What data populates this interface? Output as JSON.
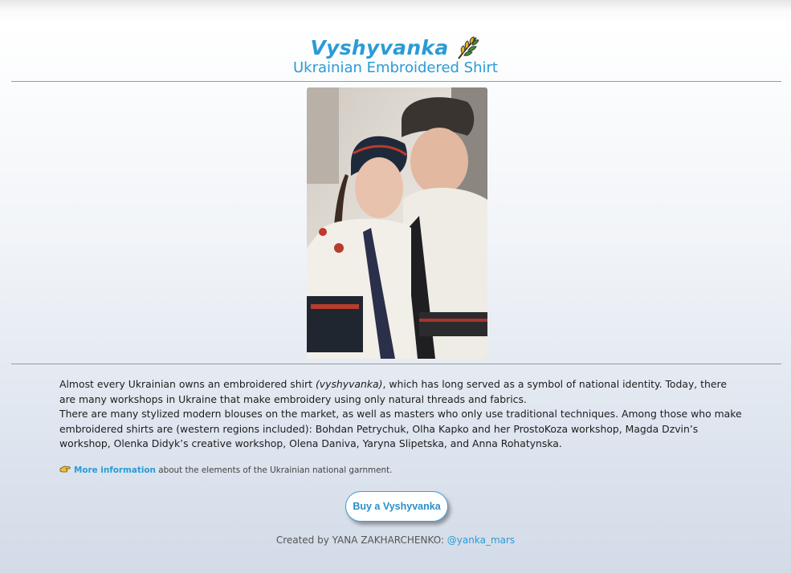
{
  "header": {
    "title": "Vyshyvanka",
    "subtitle": "Ukrainian Embroidered Shirt",
    "title_icon": "wheat-icon"
  },
  "content": {
    "p1_before": "Almost every Ukrainian owns an embroidered shirt ",
    "p1_italic": "(vyshyvanka)",
    "p1_after": ", which has long served as a symbol of national identity. Today, there are many workshops in Ukraine that make embroidery using only natural threads and fabrics.",
    "p2": "There are many stylized modern blouses on the market, as well as masters who only use traditional techniques. Among those who make embroidered shirts are (western regions included): Bohdan Petrychuk, Olha Kapko and her ProstoKoza workshop, Magda Dzvin’s workshop, Olenka Didyk’s creative workshop, Olena Daniva, Yaryna Slipetska, and Anna Rohatynska."
  },
  "more_info": {
    "icon": "pointing-hand-icon",
    "link_label": "More information",
    "rest": " about the elements of the Ukrainian national garnment."
  },
  "buy_button": {
    "label": "Buy a Vyshyvanka"
  },
  "footer": {
    "prefix": "Created by YANA ZAKHARCHENKO: ",
    "handle": "@yanka_mars"
  },
  "colors": {
    "accent": "#2a9bd6",
    "rule": "#9a9a9a"
  }
}
